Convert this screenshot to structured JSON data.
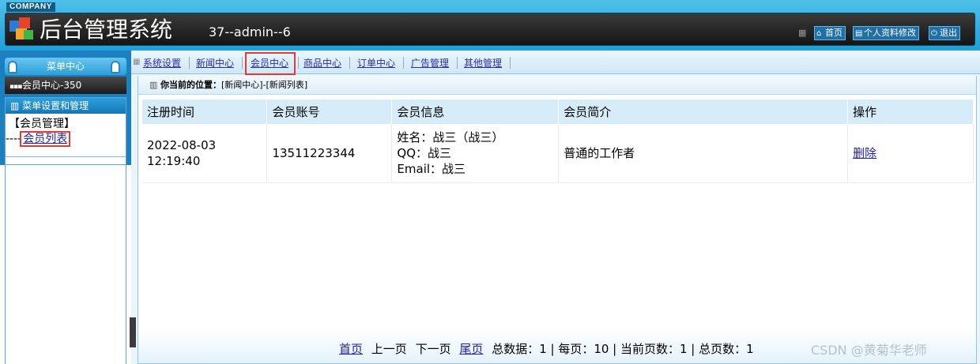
{
  "header": {
    "company": "COMPANY",
    "title": "后台管理系统",
    "user_info": "37--admin--6",
    "buttons": [
      {
        "label": "首页",
        "icon": "home-icon"
      },
      {
        "label": "个人资料修改",
        "icon": "profile-icon"
      },
      {
        "label": "退出",
        "icon": "power-icon"
      }
    ]
  },
  "sidebar": {
    "menu_center": "菜单中心",
    "current": "会员中心-350",
    "panel_title": "菜单设置和管理",
    "group": "【会员管理】",
    "link_prefix": "----",
    "link": "会员列表"
  },
  "topnav": {
    "items": [
      "系统设置",
      "新闻中心",
      "会员中心",
      "商品中心",
      "订单中心",
      "广告管理",
      "其他管理"
    ],
    "active_index": 2
  },
  "location": {
    "label": "你当前的位置：",
    "path": "[新闻中心]-[新闻列表]"
  },
  "table": {
    "headers": [
      "注册时间",
      "会员账号",
      "会员信息",
      "会员简介",
      "操作"
    ],
    "rows": [
      {
        "reg_date": "2022-08-03",
        "reg_time": "12:19:40",
        "account": "13511223344",
        "info_name": "姓名：战三（战三）",
        "info_qq": "QQ：战三",
        "info_email": "Email：战三",
        "intro": "普通的工作者",
        "action": "删除"
      }
    ]
  },
  "pager": {
    "first": "首页",
    "prev": "上一页",
    "next": "下一页",
    "last": "尾页",
    "summary": "总数据：1 | 每页：10 | 当前页数：1 | 总页数：1"
  },
  "watermark": "CSDN @黄菊华老师"
}
